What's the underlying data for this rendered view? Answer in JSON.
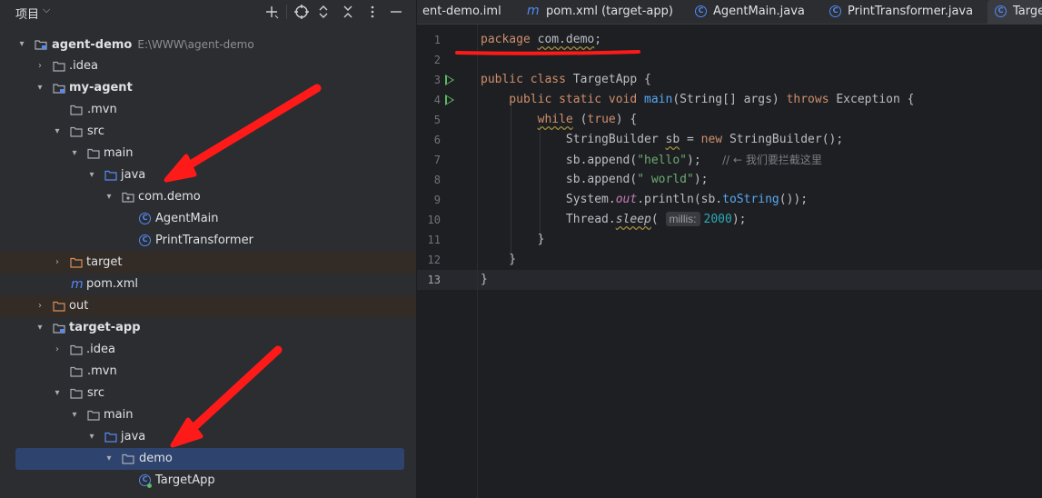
{
  "project_panel": {
    "title": "项目",
    "toolbar_icons": [
      "add-icon",
      "target-icon",
      "expand-all-icon",
      "collapse-all-icon",
      "more-icon",
      "minimize-icon"
    ],
    "tree": [
      {
        "label": "agent-demo",
        "path": "E:\\WWW\\agent-demo"
      },
      {
        "label": ".idea"
      },
      {
        "label": "my-agent"
      },
      {
        "label": ".mvn"
      },
      {
        "label": "src"
      },
      {
        "label": "main"
      },
      {
        "label": "java"
      },
      {
        "label": "com.demo"
      },
      {
        "label": "AgentMain"
      },
      {
        "label": "PrintTransformer"
      },
      {
        "label": "target"
      },
      {
        "label": "pom.xml"
      },
      {
        "label": "out"
      },
      {
        "label": "target-app"
      },
      {
        "label": ".idea"
      },
      {
        "label": ".mvn"
      },
      {
        "label": "src"
      },
      {
        "label": "main"
      },
      {
        "label": "java"
      },
      {
        "label": "demo"
      },
      {
        "label": "TargetApp"
      }
    ]
  },
  "tabs": [
    {
      "label": "ent-demo.iml"
    },
    {
      "label": "pom.xml (target-app)"
    },
    {
      "label": "AgentMain.java"
    },
    {
      "label": "PrintTransformer.java"
    },
    {
      "label": "Targe"
    }
  ],
  "editor": {
    "line_numbers": [
      "1",
      "2",
      "3",
      "4",
      "5",
      "6",
      "7",
      "8",
      "9",
      "10",
      "11",
      "12",
      "13"
    ],
    "code": {
      "l1_kw": "package",
      "l1_pkg": "com.demo",
      "l1_end": ";",
      "l3_a": "public class ",
      "l3_b": "TargetApp {",
      "l4_a": "    public static void ",
      "l4_b": "main",
      "l4_c": "(String[] args) ",
      "l4_d": "throws ",
      "l4_e": "Exception {",
      "l5_a": "        ",
      "l5_b": "while",
      "l5_c": " (",
      "l5_d": "true",
      "l5_e": ") {",
      "l6_a": "            StringBuilder ",
      "l6_b": "sb",
      "l6_c": " = ",
      "l6_d": "new ",
      "l6_e": "StringBuilder();",
      "l7_a": "            sb.",
      "l7_b": "append",
      "l7_c": "(",
      "l7_d": "\"hello\"",
      "l7_e": ");   ",
      "l7_f": "// ← 我们要拦截这里",
      "l8_a": "            sb.",
      "l8_b": "append",
      "l8_c": "(",
      "l8_d": "\" world\"",
      "l8_e": ");",
      "l9_a": "            System.",
      "l9_b": "out",
      "l9_c": ".",
      "l9_d": "println",
      "l9_e": "(sb.",
      "l9_f": "toString",
      "l9_g": "());",
      "l10_a": "            Thread.",
      "l10_b": "sleep",
      "l10_c": "( ",
      "l10_hint": "millis:",
      "l10_d": "2000",
      "l10_e": ");",
      "l11": "        }",
      "l12": "    }",
      "l13": "}"
    }
  },
  "colors": {
    "background": "#1e1f22",
    "panel": "#2b2d30",
    "selection": "#2e436e",
    "keyword": "#cf8e6d",
    "function": "#56a8f5",
    "string": "#6aab73",
    "number": "#2aacb8",
    "annotation_red": "#ff1a1a"
  }
}
